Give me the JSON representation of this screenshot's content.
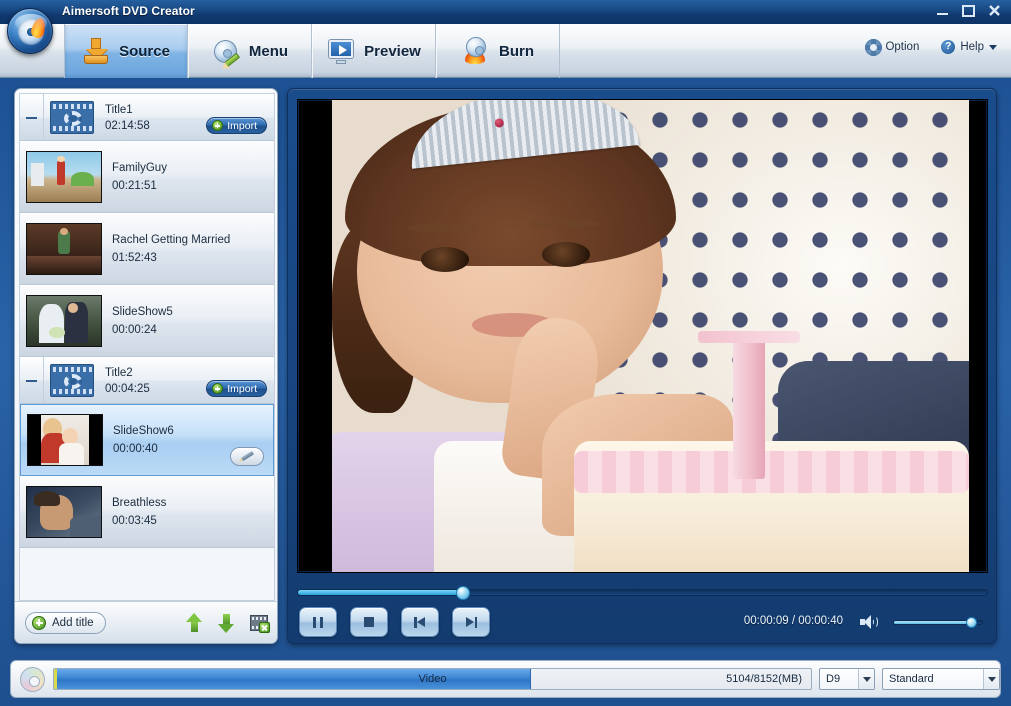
{
  "window": {
    "title": "Aimersoft DVD Creator",
    "minimize_label": "minimize",
    "maximize_label": "maximize",
    "close_label": "close"
  },
  "tabs": [
    {
      "label": "Source",
      "icon": "source-tray-icon",
      "active": true
    },
    {
      "label": "Menu",
      "icon": "disc-pencil-icon",
      "active": false
    },
    {
      "label": "Preview",
      "icon": "monitor-play-icon",
      "active": false
    },
    {
      "label": "Burn",
      "icon": "disc-flame-icon",
      "active": false
    }
  ],
  "header_links": {
    "option_label": "Option",
    "help_label": "Help"
  },
  "sidebar": {
    "groups": [
      {
        "name": "Title1",
        "duration": "02:14:58",
        "import_label": "Import",
        "clips": [
          {
            "name": "FamilyGuy",
            "duration": "00:21:51",
            "selected": false
          },
          {
            "name": "Rachel Getting Married",
            "duration": "01:52:43",
            "selected": false
          },
          {
            "name": "SlideShow5",
            "duration": "00:00:24",
            "selected": false
          }
        ]
      },
      {
        "name": "Title2",
        "duration": "00:04:25",
        "import_label": "Import",
        "clips": [
          {
            "name": "SlideShow6",
            "duration": "00:00:40",
            "selected": true
          },
          {
            "name": "Breathless",
            "duration": "00:03:45",
            "selected": false
          }
        ]
      }
    ],
    "toolbar": {
      "add_title_label": "Add title",
      "move_up_label": "Move up",
      "move_down_label": "Move down",
      "delete_label": "Delete title"
    }
  },
  "player": {
    "current_time": "00:00:09",
    "total_time": "00:00:40",
    "time_display": "00:00:09 / 00:00:40",
    "progress_percent": 24,
    "volume_percent": 88,
    "buttons": {
      "pause": "Pause",
      "stop": "Stop",
      "previous": "Previous",
      "next": "Next"
    }
  },
  "status_bar": {
    "capacity_label": "Video",
    "capacity_used_mb": 5104,
    "capacity_total_mb": 8152,
    "capacity_text": "5104/8152(MB)",
    "capacity_percent": 63,
    "disc_type": "D9",
    "quality": "Standard"
  },
  "colors": {
    "accent_blue": "#2f6cb0",
    "title_bar": "#17457f",
    "panel_blue": "#17457f",
    "selection": "#a8cef2",
    "progress_cyan": "#27a3dd",
    "capacity_fill": "#3d85d4"
  }
}
